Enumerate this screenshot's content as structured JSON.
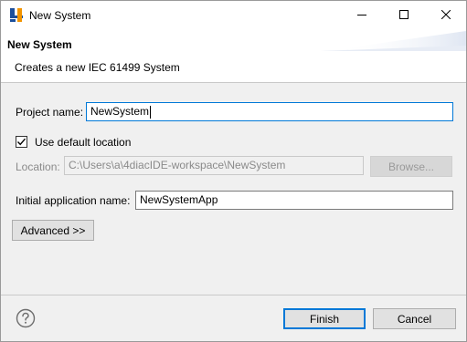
{
  "window": {
    "title": "New System",
    "app_icon": "4diac-logo-icon",
    "controls": [
      "minimize-icon",
      "maximize-icon",
      "close-icon"
    ]
  },
  "banner": {
    "title": "New System",
    "description": "Creates a new IEC 61499 System"
  },
  "form": {
    "project_name_label": "Project name:",
    "project_name_value": "NewSystem",
    "use_default_location_label": "Use default location",
    "use_default_location_checked": true,
    "location_label": "Location:",
    "location_value": "C:\\Users\\a\\4diacIDE-workspace\\NewSystem",
    "browse_label": "Browse...",
    "initial_app_label": "Initial application name:",
    "initial_app_value": "NewSystemApp",
    "advanced_label": "Advanced >>"
  },
  "footer": {
    "help_icon": "help-icon",
    "finish_label": "Finish",
    "cancel_label": "Cancel"
  },
  "colors": {
    "accent": "#0078d7",
    "dialog_bg": "#f0f0f0"
  }
}
